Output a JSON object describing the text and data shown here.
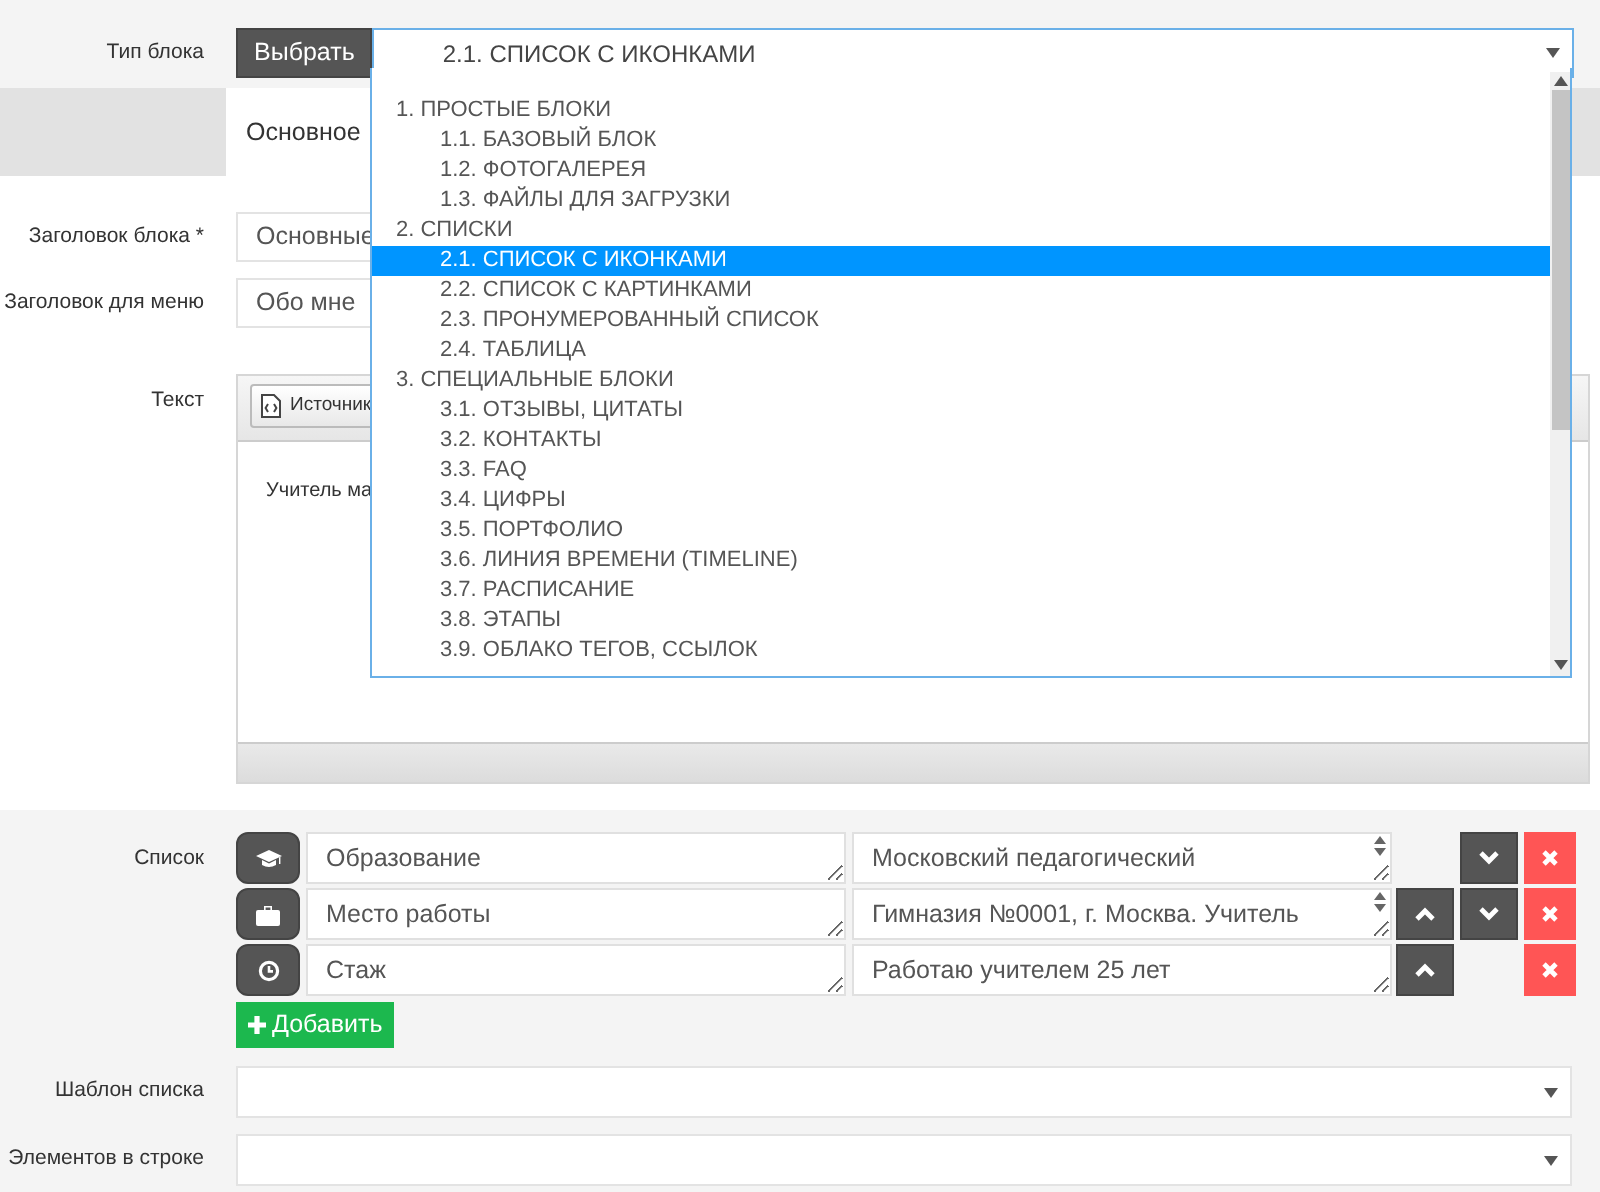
{
  "block_type": {
    "label": "Тип блока",
    "choose_button": "Выбрать",
    "value": "2.1. СПИСОК С ИКОНКАМИ"
  },
  "dropdown": {
    "options": [
      {
        "label": "1. ПРОСТЫЕ БЛОКИ",
        "selected": false,
        "children": [
          {
            "label": "1.1. БАЗОВЫЙ БЛОК",
            "selected": false
          },
          {
            "label": "1.2. ФОТОГАЛЕРЕЯ",
            "selected": false
          },
          {
            "label": "1.3. ФАЙЛЫ ДЛЯ ЗАГРУЗКИ",
            "selected": false
          }
        ]
      },
      {
        "label": "2. СПИСКИ",
        "selected": false,
        "children": [
          {
            "label": "2.1. СПИСОК С ИКОНКАМИ",
            "selected": true
          },
          {
            "label": "2.2. СПИСОК С КАРТИНКАМИ",
            "selected": false
          },
          {
            "label": "2.3. ПРОНУМЕРОВАННЫЙ СПИСОК",
            "selected": false
          },
          {
            "label": "2.4. ТАБЛИЦА",
            "selected": false
          }
        ]
      },
      {
        "label": "3. СПЕЦИАЛЬНЫЕ БЛОКИ",
        "selected": false,
        "children": [
          {
            "label": "3.1. ОТЗЫВЫ, ЦИТАТЫ",
            "selected": false
          },
          {
            "label": "3.2. КОНТАКТЫ",
            "selected": false
          },
          {
            "label": "3.3. FAQ",
            "selected": false
          },
          {
            "label": "3.4. ЦИФРЫ",
            "selected": false
          },
          {
            "label": "3.5. ПОРТФОЛИО",
            "selected": false
          },
          {
            "label": "3.6. ЛИНИЯ ВРЕМЕНИ (TIMELINE)",
            "selected": false
          },
          {
            "label": "3.7. РАСПИСАНИЕ",
            "selected": false
          },
          {
            "label": "3.8. ЭТАПЫ",
            "selected": false
          },
          {
            "label": "3.9. ОБЛАКО ТЕГОВ, ССЫЛОК",
            "selected": false
          }
        ]
      }
    ]
  },
  "tabs": [
    {
      "label": "Основное",
      "selected": true
    }
  ],
  "fields": [
    {
      "label": "Заголовок блока *",
      "value": "Основные"
    },
    {
      "label": "Заголовок для меню",
      "value": "Обо мне"
    }
  ],
  "text_editor": {
    "label": "Текст",
    "source_button": "Источник",
    "content": "Учитель ма"
  },
  "list": {
    "label": "Список",
    "items": [
      {
        "kind": "graduation-cap",
        "title": "Образование",
        "value": "Московский педагогический",
        "can_move_up": false,
        "can_move_down": true,
        "scrollable": true
      },
      {
        "kind": "briefcase",
        "title": "Место работы",
        "value": "Гимназия №0001, г. Москва. Учитель",
        "can_move_up": true,
        "can_move_down": true,
        "scrollable": true
      },
      {
        "kind": "clock",
        "title": "Стаж",
        "value": "Работаю учителем 25 лет",
        "can_move_up": true,
        "can_move_down": false,
        "scrollable": false
      }
    ],
    "add_button": "Добавить"
  },
  "selects": [
    {
      "label": "Шаблон списка"
    },
    {
      "label": "Элементов в строке"
    }
  ]
}
